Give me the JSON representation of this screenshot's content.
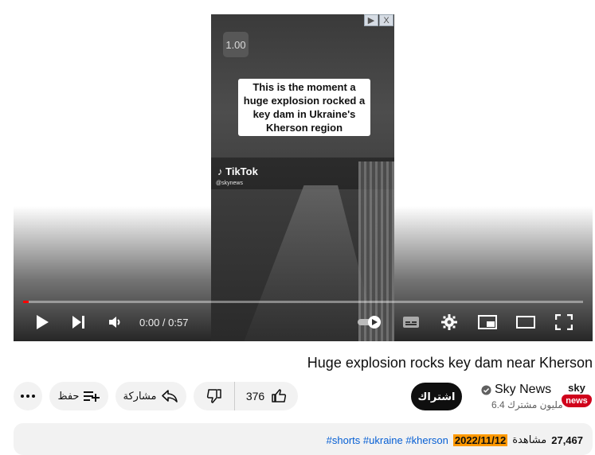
{
  "player": {
    "ad_marker": "▶",
    "ad_close": "X",
    "speed": "1.00",
    "caption": "This is the moment a\nhuge explosion rocked a\nkey dam in Ukraine's\nKherson region",
    "watermark": "TikTok",
    "watermark_handle": "@skynews",
    "current_time": "0:00",
    "separator": " / ",
    "duration": "0:57",
    "progress": 0.01
  },
  "video": {
    "title": "Huge explosion rocks key dam near Kherson"
  },
  "actions": {
    "save_label": "حفظ",
    "share_label": "مشاركة",
    "like_count": "376"
  },
  "channel": {
    "name": "Sky News",
    "subscribers": "6.4 مليون مشترك",
    "subscribe_label": "اشتراك",
    "logo_top": "sky",
    "logo_bottom": "news"
  },
  "description": {
    "views": "27,467",
    "views_label": "مشاهدة",
    "date": "2022/11/12",
    "tags": "#shorts #ukraine #kherson"
  },
  "colors": {
    "accent_red": "#ff0000",
    "date_highlight": "#ff9900",
    "link_blue": "#065fd4",
    "subscribe_bg": "#0f0f0f"
  }
}
